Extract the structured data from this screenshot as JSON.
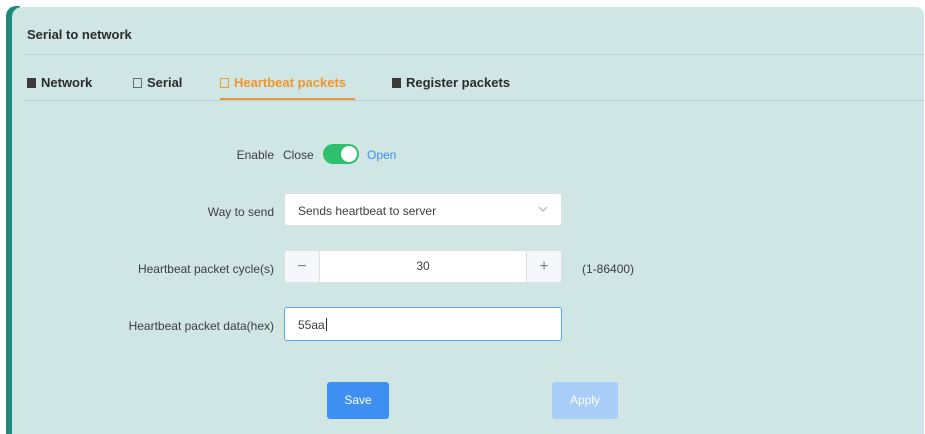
{
  "panel": {
    "title": "Serial to network"
  },
  "tabs": [
    {
      "label": "Network",
      "active": false,
      "icon": "clipboard-icon"
    },
    {
      "label": "Serial",
      "active": false,
      "icon": "calendar-icon"
    },
    {
      "label": "Heartbeat packets",
      "active": true,
      "icon": "calendar-icon"
    },
    {
      "label": "Register packets",
      "active": false,
      "icon": "clipboard-icon"
    }
  ],
  "form": {
    "enable": {
      "label": "Enable",
      "off_text": "Close",
      "on_text": "Open",
      "value": true
    },
    "way_to_send": {
      "label": "Way to send",
      "value": "Sends heartbeat to server"
    },
    "cycle": {
      "label": "Heartbeat packet cycle(s)",
      "value": "30",
      "minus": "−",
      "plus": "+",
      "range_hint": "(1-86400)"
    },
    "data_hex": {
      "label": "Heartbeat packet data(hex)",
      "value": "55aa"
    }
  },
  "actions": {
    "save_label": "Save",
    "apply_label": "Apply"
  },
  "colors": {
    "panel_bg": "#cfe6e5",
    "accent_left": "#1e8a7a",
    "active_tab": "#f0962e",
    "switch_on": "#2fc06e",
    "link_blue": "#3e8ef0",
    "primary_button": "#3d8ff2",
    "disabled_button": "#a8cdf6"
  }
}
